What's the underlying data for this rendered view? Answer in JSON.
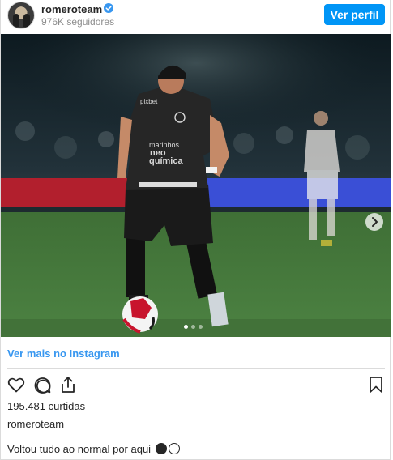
{
  "header": {
    "username": "romeroteam",
    "followers": "976K seguidores",
    "view_profile_label": "Ver perfil"
  },
  "post": {
    "carousel_count": 3,
    "carousel_active_index": 0,
    "more_link_label": "Ver mais no Instagram",
    "likes": "195.481 curtidas",
    "caption_user": "romeroteam",
    "caption_text": "Voltou tudo ao normal por aqui"
  },
  "image_text": {
    "sponsor_chest": "marinhos",
    "sponsor_chest_2": "neo",
    "sponsor_chest_3": "química",
    "sponsor_top": "pixbet"
  },
  "colors": {
    "accent": "#0095f6",
    "link": "#3897f0",
    "text": "#262626",
    "muted": "#8e8e8e"
  }
}
